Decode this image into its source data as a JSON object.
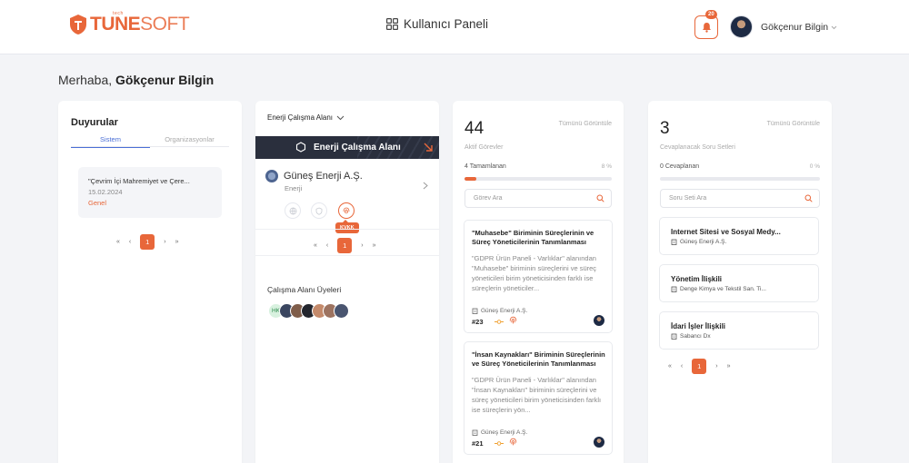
{
  "header": {
    "logo_tune": "TUNE",
    "logo_soft": "SOFT",
    "logo_tagline": "tech",
    "panel_title": "Kullanıcı Paneli",
    "notification_count": "20",
    "user_name": "Gökçenur Bilgin"
  },
  "greeting": {
    "prefix": "Merhaba,",
    "name": "Gökçenur Bilgin"
  },
  "announcements": {
    "title": "Duyurular",
    "tabs": [
      {
        "label": "Sistem",
        "active": true
      },
      {
        "label": "Organizasyonlar",
        "active": false
      }
    ],
    "items": [
      {
        "title": "\"Çevrim İçi Mahremiyet ve Çere...",
        "date": "15.02.2024",
        "tag": "Genel"
      }
    ],
    "pager": {
      "first": "«",
      "prev": "‹",
      "current": "1",
      "next": "›",
      "last": "»"
    }
  },
  "workspace": {
    "selector_label": "Enerji Çalışma Alanı",
    "banner_title": "Enerji Çalışma Alanı",
    "company_name": "Güneş Enerji A.Ş.",
    "sector": "Enerji",
    "active_module_tooltip": "KVKK",
    "pager": {
      "first": "«",
      "prev": "‹",
      "current": "1",
      "next": "›",
      "last": "»"
    },
    "members_title": "Çalışma Alanı Üyeleri",
    "members": [
      {
        "initials": "HK",
        "color": "#d8f1df"
      },
      {
        "initials": "",
        "color": "#3a4660"
      },
      {
        "initials": "",
        "color": "#7f5d4a"
      },
      {
        "initials": "",
        "color": "#23262e"
      },
      {
        "initials": "",
        "color": "#c48a6b"
      },
      {
        "initials": "",
        "color": "#9d7360"
      },
      {
        "initials": "",
        "color": "#4a5570"
      }
    ]
  },
  "tasks": {
    "count": "44",
    "view_all": "Tümünü Görüntüle",
    "subtitle": "Aktif Görevler",
    "progress_label": "4 Tamamlanan",
    "progress_pct_label": "8 %",
    "progress_fraction": 0.08,
    "search_placeholder": "Görev Ara",
    "items": [
      {
        "title": "\"Muhasebe\" Biriminin Süreçlerinin ve Süreç Yöneticilerinin Tanımlanması",
        "desc": "\"GDPR Ürün Paneli - Varlıklar\" alanından \"Muhasebe\" biriminin süreçlerini ve süreç yöneticileri birim yöneticisinden farklı ise süreçlerin yöneticiler...",
        "company": "Güneş Enerji A.Ş.",
        "id": "#23"
      },
      {
        "title": "\"İnsan Kaynakları\" Biriminin Süreçlerinin ve Süreç Yöneticilerinin Tanımlanması",
        "desc": "\"GDPR Ürün Paneli - Varlıklar\" alanından \"İnsan Kaynakları\" biriminin süreçlerini ve süreç yöneticileri birim yöneticisinden farklı ise süreçlerin yön...",
        "company": "Güneş Enerji A.Ş.",
        "id": "#21"
      }
    ]
  },
  "question_sets": {
    "count": "3",
    "view_all": "Tümünü Görüntüle",
    "subtitle": "Cevaplanacak Soru Setleri",
    "progress_label": "0 Cevaplanan",
    "progress_pct_label": "0 %",
    "progress_fraction": 0,
    "search_placeholder": "Soru Seti Ara",
    "items": [
      {
        "title": "Internet Sitesi ve Sosyal Medy...",
        "company": "Güneş Enerji A.Ş."
      },
      {
        "title": "Yönetim İlişkili",
        "company": "Denge Kimya ve Tekstil San. Ti..."
      },
      {
        "title": "İdari İşler İlişkili",
        "company": "Sabancı Dx"
      }
    ],
    "pager": {
      "first": "«",
      "prev": "‹",
      "current": "1",
      "next": "›",
      "last": "»"
    }
  },
  "colors": {
    "accent": "#e8673a",
    "tab_active": "#4b6fd6",
    "banner": "#2a2f3d"
  }
}
